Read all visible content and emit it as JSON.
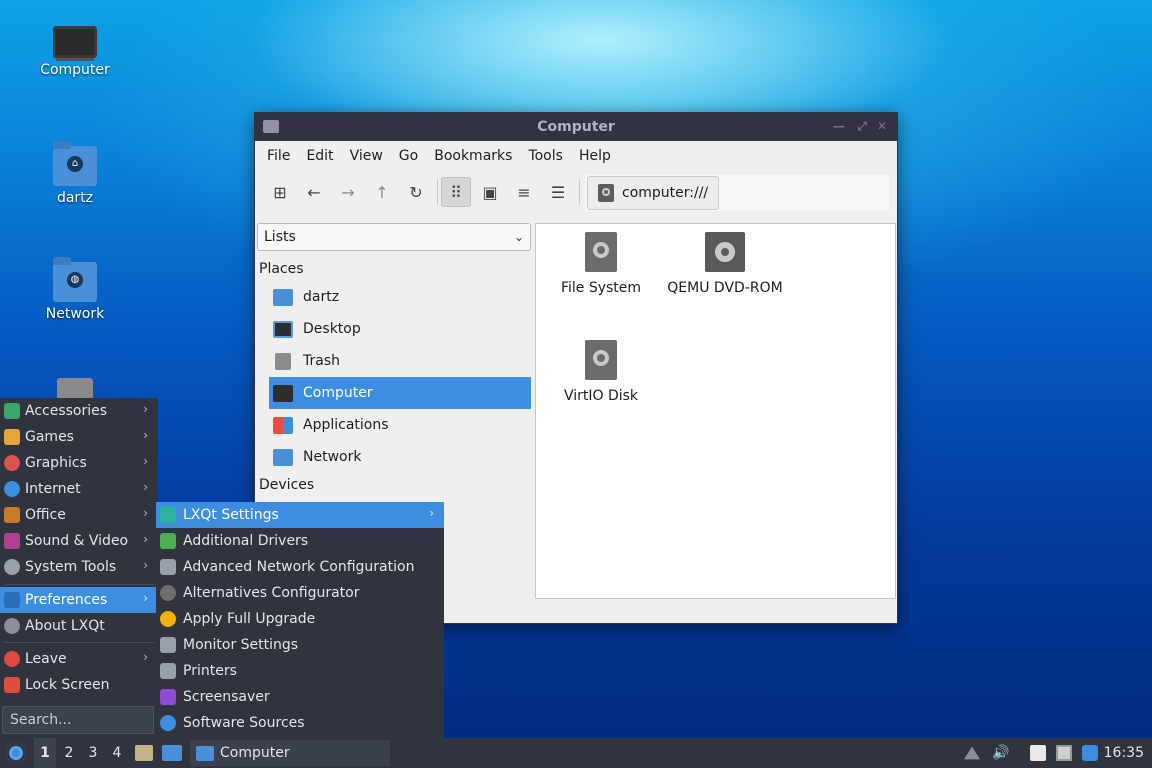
{
  "desktop": {
    "icons": [
      {
        "label": "Computer"
      },
      {
        "label": "dartz"
      },
      {
        "label": "Network"
      }
    ]
  },
  "window": {
    "title": "Computer",
    "menu": [
      "File",
      "Edit",
      "Go",
      "View",
      "Bookmarks",
      "Tools",
      "Help"
    ],
    "menu_order": [
      "File",
      "Edit",
      "View",
      "Go",
      "Bookmarks",
      "Tools",
      "Help"
    ],
    "path": "computer:///",
    "side_view": "Lists",
    "places_header": "Places",
    "places": [
      {
        "label": "dartz",
        "icon": "home-folder-icon"
      },
      {
        "label": "Desktop",
        "icon": "desktop-icon"
      },
      {
        "label": "Trash",
        "icon": "trash-icon"
      },
      {
        "label": "Computer",
        "icon": "computer-icon",
        "selected": true
      },
      {
        "label": "Applications",
        "icon": "applications-icon"
      },
      {
        "label": "Network",
        "icon": "network-icon"
      }
    ],
    "devices_header": "Devices",
    "files": [
      {
        "label": "File System",
        "icon": "harddisk-icon"
      },
      {
        "label": "QEMU DVD-ROM",
        "icon": "optical-disc-icon"
      },
      {
        "label": "VirtIO Disk",
        "icon": "harddisk-icon"
      }
    ]
  },
  "app_menu": {
    "items": [
      {
        "label": "Accessories",
        "color": "#3aa76d"
      },
      {
        "label": "Games",
        "color": "#e8a33b"
      },
      {
        "label": "Graphics",
        "color": "#d9534f"
      },
      {
        "label": "Internet",
        "color": "#3d8ee1"
      },
      {
        "label": "Office",
        "color": "#c97b2c"
      },
      {
        "label": "Sound & Video",
        "color": "#b0418f"
      },
      {
        "label": "System Tools",
        "color": "#9aa0aa"
      }
    ],
    "preferences": "Preferences",
    "about": "About LXQt",
    "leave": "Leave",
    "lock": "Lock Screen",
    "search_placeholder": "Search..."
  },
  "submenu": {
    "items": [
      {
        "label": "LXQt Settings",
        "color": "#2bb3a0"
      },
      {
        "label": "Additional Drivers",
        "color": "#4caf50"
      },
      {
        "label": "Advanced Network Configuration",
        "color": "#9aa0aa"
      },
      {
        "label": "Alternatives Configurator",
        "color": "#6d6d6d"
      },
      {
        "label": "Apply Full Upgrade",
        "color": "#f0b400"
      },
      {
        "label": "Monitor Settings",
        "color": "#9aa0aa"
      },
      {
        "label": "Printers",
        "color": "#9aa0aa"
      },
      {
        "label": "Screensaver",
        "color": "#8e4ad8"
      },
      {
        "label": "Software Sources",
        "color": "#3d8ee1"
      }
    ]
  },
  "taskbar": {
    "desktops": [
      "1",
      "2",
      "3",
      "4"
    ],
    "current_desktop": "1",
    "task": "Computer",
    "clock": "16:35"
  }
}
